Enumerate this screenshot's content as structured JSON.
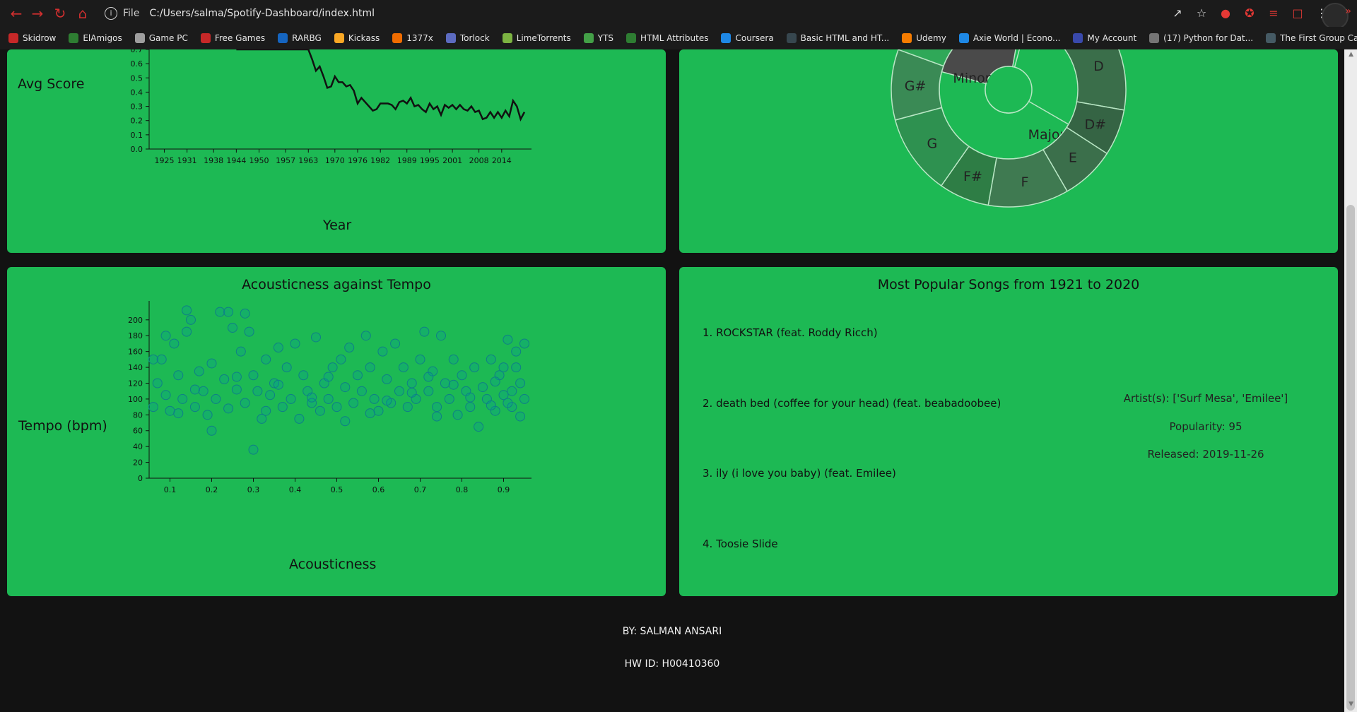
{
  "browser": {
    "scheme_label": "File",
    "url": "C:/Users/salma/Spotify-Dashboard/index.html",
    "bookmarks": [
      {
        "label": "Skidrow",
        "color": "#c62828"
      },
      {
        "label": "ElAmigos",
        "color": "#2e7d32"
      },
      {
        "label": "Game PC",
        "color": "#9e9e9e"
      },
      {
        "label": "Free Games",
        "color": "#c62828"
      },
      {
        "label": "RARBG",
        "color": "#1565c0"
      },
      {
        "label": "Kickass",
        "color": "#f9a825"
      },
      {
        "label": "1377x",
        "color": "#ef6c00"
      },
      {
        "label": "Torlock",
        "color": "#5c6bc0"
      },
      {
        "label": "LimeTorrents",
        "color": "#7cb342"
      },
      {
        "label": "YTS",
        "color": "#43a047"
      },
      {
        "label": "HTML Attributes",
        "color": "#2e7d32"
      },
      {
        "label": "Coursera",
        "color": "#1e88e5"
      },
      {
        "label": "Basic HTML and HT...",
        "color": "#37474f"
      },
      {
        "label": "Udemy",
        "color": "#f57c00"
      },
      {
        "label": "Axie World | Econo...",
        "color": "#1e88e5"
      },
      {
        "label": "My Account",
        "color": "#3949ab"
      },
      {
        "label": "(17) Python for Dat...",
        "color": "#757575"
      },
      {
        "label": "The First Group Car...",
        "color": "#455a64"
      }
    ]
  },
  "line_card": {
    "ylabel": "Avg Score",
    "xlabel": "Year"
  },
  "scatter_card": {
    "title": "Acousticness against Tempo",
    "ylabel": "Tempo (bpm)",
    "xlabel": "Acousticness"
  },
  "songs_card": {
    "title": "Most Popular Songs from 1921 to 2020",
    "songs": [
      "1. ROCKSTAR (feat. Roddy Ricch)",
      "2. death bed (coffee for your head) (feat. beabadoobee)",
      "3. ily (i love you baby) (feat. Emilee)",
      "4. Toosie Slide"
    ],
    "details": {
      "artists": "Artist(s): ['Surf Mesa', 'Emilee']",
      "popularity": "Popularity: 95",
      "released": "Released: 2019-11-26"
    }
  },
  "footer": {
    "author": "BY: SALMAN ANSARI",
    "hw_id": "HW ID: H00410360"
  },
  "chart_data": [
    {
      "type": "line",
      "title": "",
      "xlabel": "Year",
      "ylabel": "Avg Score",
      "xlim": [
        1921,
        2020
      ],
      "ylim": [
        0,
        0.7
      ],
      "x_ticks": [
        "1925",
        "1931",
        "1938",
        "1944",
        "1950",
        "1957",
        "1963",
        "1970",
        "1976",
        "1982",
        "1989",
        "1995",
        "2001",
        "2008",
        "2014"
      ],
      "y_ticks": [
        "0.0",
        "0.1",
        "0.2",
        "0.3",
        "0.4",
        "0.5",
        "0.6",
        "0.7"
      ],
      "visible_points": [
        [
          1944,
          0.7
        ],
        [
          1963,
          0.7
        ],
        [
          1964,
          0.63
        ],
        [
          1965,
          0.55
        ],
        [
          1966,
          0.58
        ],
        [
          1967,
          0.51
        ],
        [
          1968,
          0.43
        ],
        [
          1969,
          0.44
        ],
        [
          1970,
          0.51
        ],
        [
          1971,
          0.47
        ],
        [
          1972,
          0.47
        ],
        [
          1973,
          0.44
        ],
        [
          1974,
          0.45
        ],
        [
          1975,
          0.41
        ],
        [
          1976,
          0.32
        ],
        [
          1977,
          0.36
        ],
        [
          1978,
          0.33
        ],
        [
          1979,
          0.3
        ],
        [
          1980,
          0.27
        ],
        [
          1981,
          0.28
        ],
        [
          1982,
          0.32
        ],
        [
          1983,
          0.32
        ],
        [
          1984,
          0.32
        ],
        [
          1985,
          0.31
        ],
        [
          1986,
          0.28
        ],
        [
          1987,
          0.33
        ],
        [
          1988,
          0.34
        ],
        [
          1989,
          0.32
        ],
        [
          1990,
          0.36
        ],
        [
          1991,
          0.3
        ],
        [
          1992,
          0.31
        ],
        [
          1993,
          0.28
        ],
        [
          1994,
          0.26
        ],
        [
          1995,
          0.32
        ],
        [
          1996,
          0.28
        ],
        [
          1997,
          0.3
        ],
        [
          1998,
          0.24
        ],
        [
          1999,
          0.31
        ],
        [
          2000,
          0.29
        ],
        [
          2001,
          0.31
        ],
        [
          2002,
          0.28
        ],
        [
          2003,
          0.31
        ],
        [
          2004,
          0.28
        ],
        [
          2005,
          0.27
        ],
        [
          2006,
          0.3
        ],
        [
          2007,
          0.26
        ],
        [
          2008,
          0.27
        ],
        [
          2009,
          0.21
        ],
        [
          2010,
          0.22
        ],
        [
          2011,
          0.26
        ],
        [
          2012,
          0.22
        ],
        [
          2013,
          0.26
        ],
        [
          2014,
          0.22
        ],
        [
          2015,
          0.27
        ],
        [
          2016,
          0.23
        ],
        [
          2017,
          0.34
        ],
        [
          2018,
          0.3
        ],
        [
          2019,
          0.21
        ],
        [
          2020,
          0.26
        ]
      ]
    },
    {
      "type": "sunburst",
      "title": "",
      "inner": [
        {
          "name": "Minor",
          "value": 0.3,
          "color": "#4a4a4a"
        },
        {
          "name": "Major",
          "value": 0.7,
          "color": "#1db954"
        }
      ],
      "outer": [
        {
          "name": "D",
          "parent": "Major",
          "color": "#3a6e4a"
        },
        {
          "name": "D#",
          "parent": "Major",
          "color": "#356444"
        },
        {
          "name": "E",
          "parent": "Major",
          "color": "#3b6f4b"
        },
        {
          "name": "F",
          "parent": "Major",
          "color": "#3f7a51"
        },
        {
          "name": "F#",
          "parent": "Major",
          "color": "#2e7d45"
        },
        {
          "name": "G",
          "parent": "Major",
          "color": "#2e9150"
        },
        {
          "name": "G#",
          "parent": "Major",
          "color": "#3a8a55"
        }
      ]
    },
    {
      "type": "scatter",
      "title": "Acousticness against Tempo",
      "xlabel": "Acousticness",
      "ylabel": "Tempo (bpm)",
      "xlim": [
        0.05,
        0.95
      ],
      "ylim": [
        0,
        215
      ],
      "x_ticks": [
        "0.1",
        "0.2",
        "0.3",
        "0.4",
        "0.5",
        "0.6",
        "0.7",
        "0.8",
        "0.9"
      ],
      "y_ticks": [
        "0",
        "20",
        "40",
        "60",
        "80",
        "100",
        "120",
        "140",
        "160",
        "180",
        "200"
      ],
      "points": [
        [
          0.06,
          150
        ],
        [
          0.07,
          120
        ],
        [
          0.08,
          150
        ],
        [
          0.09,
          180
        ],
        [
          0.09,
          105
        ],
        [
          0.1,
          85
        ],
        [
          0.11,
          170
        ],
        [
          0.12,
          130
        ],
        [
          0.13,
          100
        ],
        [
          0.14,
          212
        ],
        [
          0.14,
          185
        ],
        [
          0.15,
          200
        ],
        [
          0.16,
          90
        ],
        [
          0.17,
          135
        ],
        [
          0.18,
          110
        ],
        [
          0.19,
          80
        ],
        [
          0.2,
          145
        ],
        [
          0.2,
          60
        ],
        [
          0.21,
          100
        ],
        [
          0.22,
          210
        ],
        [
          0.23,
          125
        ],
        [
          0.24,
          210
        ],
        [
          0.25,
          190
        ],
        [
          0.26,
          112
        ],
        [
          0.27,
          160
        ],
        [
          0.28,
          208
        ],
        [
          0.28,
          95
        ],
        [
          0.29,
          185
        ],
        [
          0.3,
          130
        ],
        [
          0.3,
          36
        ],
        [
          0.31,
          110
        ],
        [
          0.32,
          75
        ],
        [
          0.33,
          150
        ],
        [
          0.34,
          105
        ],
        [
          0.35,
          120
        ],
        [
          0.36,
          165
        ],
        [
          0.37,
          90
        ],
        [
          0.38,
          140
        ],
        [
          0.39,
          100
        ],
        [
          0.4,
          170
        ],
        [
          0.41,
          75
        ],
        [
          0.42,
          130
        ],
        [
          0.43,
          110
        ],
        [
          0.44,
          95
        ],
        [
          0.45,
          178
        ],
        [
          0.46,
          85
        ],
        [
          0.47,
          120
        ],
        [
          0.48,
          100
        ],
        [
          0.49,
          140
        ],
        [
          0.5,
          90
        ],
        [
          0.51,
          150
        ],
        [
          0.52,
          115
        ],
        [
          0.53,
          165
        ],
        [
          0.54,
          95
        ],
        [
          0.55,
          130
        ],
        [
          0.56,
          110
        ],
        [
          0.57,
          180
        ],
        [
          0.58,
          140
        ],
        [
          0.59,
          100
        ],
        [
          0.6,
          85
        ],
        [
          0.61,
          160
        ],
        [
          0.62,
          125
        ],
        [
          0.63,
          95
        ],
        [
          0.64,
          170
        ],
        [
          0.65,
          110
        ],
        [
          0.66,
          140
        ],
        [
          0.67,
          90
        ],
        [
          0.68,
          120
        ],
        [
          0.69,
          100
        ],
        [
          0.7,
          150
        ],
        [
          0.71,
          185
        ],
        [
          0.72,
          110
        ],
        [
          0.73,
          135
        ],
        [
          0.74,
          90
        ],
        [
          0.75,
          180
        ],
        [
          0.76,
          120
        ],
        [
          0.77,
          100
        ],
        [
          0.78,
          150
        ],
        [
          0.79,
          80
        ],
        [
          0.8,
          130
        ],
        [
          0.81,
          110
        ],
        [
          0.82,
          90
        ],
        [
          0.83,
          140
        ],
        [
          0.84,
          65
        ],
        [
          0.85,
          115
        ],
        [
          0.86,
          100
        ],
        [
          0.87,
          150
        ],
        [
          0.88,
          85
        ],
        [
          0.89,
          130
        ],
        [
          0.9,
          105
        ],
        [
          0.91,
          175
        ],
        [
          0.92,
          90
        ],
        [
          0.93,
          160
        ],
        [
          0.94,
          120
        ],
        [
          0.94,
          78
        ],
        [
          0.93,
          140
        ],
        [
          0.92,
          110
        ],
        [
          0.91,
          95
        ],
        [
          0.12,
          82
        ],
        [
          0.24,
          88
        ],
        [
          0.36,
          118
        ],
        [
          0.48,
          128
        ],
        [
          0.58,
          82
        ],
        [
          0.68,
          108
        ],
        [
          0.78,
          118
        ],
        [
          0.88,
          122
        ],
        [
          0.16,
          112
        ],
        [
          0.26,
          128
        ],
        [
          0.44,
          102
        ],
        [
          0.62,
          98
        ],
        [
          0.72,
          128
        ],
        [
          0.82,
          102
        ],
        [
          0.87,
          92
        ],
        [
          0.9,
          140
        ],
        [
          0.95,
          170
        ],
        [
          0.95,
          100
        ],
        [
          0.06,
          90
        ],
        [
          0.33,
          85
        ],
        [
          0.52,
          72
        ],
        [
          0.74,
          78
        ]
      ]
    }
  ]
}
